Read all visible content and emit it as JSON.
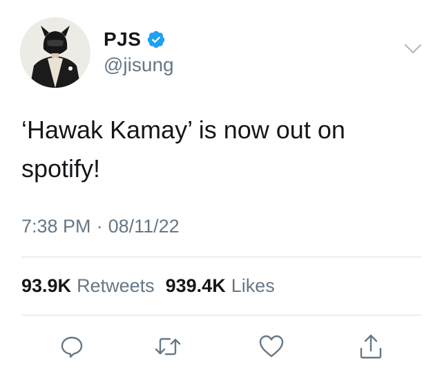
{
  "author": {
    "display_name": "PJS",
    "handle": "@jisung",
    "verified": true
  },
  "tweet": {
    "text": "‘Hawak Kamay’ is now out on spotify!",
    "time": "7:38 PM",
    "separator": "·",
    "date": "08/11/22"
  },
  "stats": {
    "retweets_count": "93.9K",
    "retweets_label": "Retweets",
    "likes_count": "939.4K",
    "likes_label": "Likes"
  },
  "icons": {
    "menu": "chevron-down-icon",
    "reply": "reply-icon",
    "retweet": "retweet-icon",
    "like": "heart-icon",
    "share": "share-icon",
    "verified": "verified-badge-icon"
  },
  "colors": {
    "accent": "#1da1f2",
    "icon": "#657786",
    "text": "#14171a",
    "muted": "#657786"
  }
}
